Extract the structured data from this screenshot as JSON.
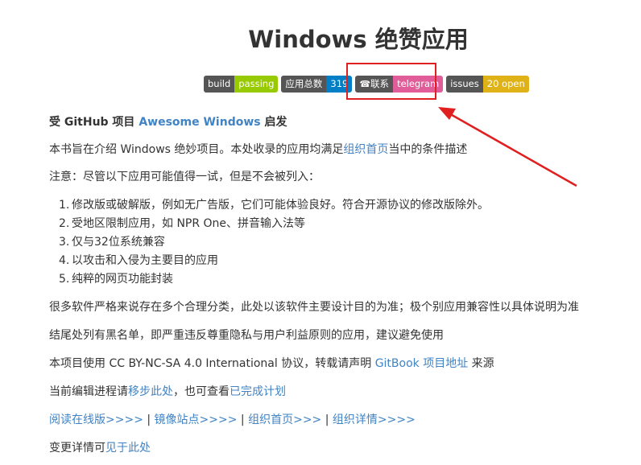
{
  "title": "Windows 绝赞应用",
  "badges": [
    {
      "label": "build",
      "value": "passing",
      "color": "#97ca00"
    },
    {
      "label": "应用总数",
      "value": "319",
      "color": "#007ec6"
    },
    {
      "label": "联系",
      "icon": "phone-icon",
      "icon_glyph": "☎",
      "value": "telegram",
      "color": "#e05d99"
    },
    {
      "label": "issues",
      "value": "20 open",
      "color": "#dfb317"
    }
  ],
  "annotation_color": "#e02020",
  "inspired": {
    "prefix": "受 GitHub 项目 ",
    "link": "Awesome Windows",
    "suffix": " 启发"
  },
  "intro": {
    "prefix": "本书旨在介绍 Windows 绝妙项目。本处收录的应用均满足",
    "link": "组织首页",
    "suffix": "当中的条件描述"
  },
  "notice": "注意：尽管以下应用可能值得一试，但是不会被列入：",
  "exclusions": [
    {
      "num": "1.",
      "text": "修改版或破解版，例如无广告版，它们可能体验良好。符合开源协议的修改版除外。"
    },
    {
      "num": "2.",
      "text": "受地区限制应用，如 NPR One、拼音输入法等"
    },
    {
      "num": "3.",
      "text": "仅与32位系统兼容"
    },
    {
      "num": "4.",
      "text": "以攻击和入侵为主要目的应用"
    },
    {
      "num": "5.",
      "text": "纯粹的网页功能封装"
    }
  ],
  "classification_note": "很多软件严格来说存在多个合理分类，此处以该软件主要设计目的为准；极个别应用兼容性以具体说明为准",
  "blacklist_note": "结尾处列有黑名单，即严重违反尊重隐私与用户利益原则的应用，建议避免使用",
  "license": {
    "prefix": "本项目使用 CC BY-NC-SA 4.0 International 协议，转载请声明 ",
    "link": "GitBook 项目地址",
    "suffix": " 来源"
  },
  "progress": {
    "prefix": "当前编辑进程请",
    "link1": "移步此处",
    "middle": "，也可查看",
    "link2": "已完成计划"
  },
  "nav_links": [
    {
      "label": "阅读在线版>>>>"
    },
    {
      "label": "镜像站点>>>>"
    },
    {
      "label": "组织首页>>>"
    },
    {
      "label": "组织详情>>>>"
    }
  ],
  "nav_separator": "|",
  "changelog": {
    "prefix": "变更详情可",
    "link": "见于此处"
  }
}
